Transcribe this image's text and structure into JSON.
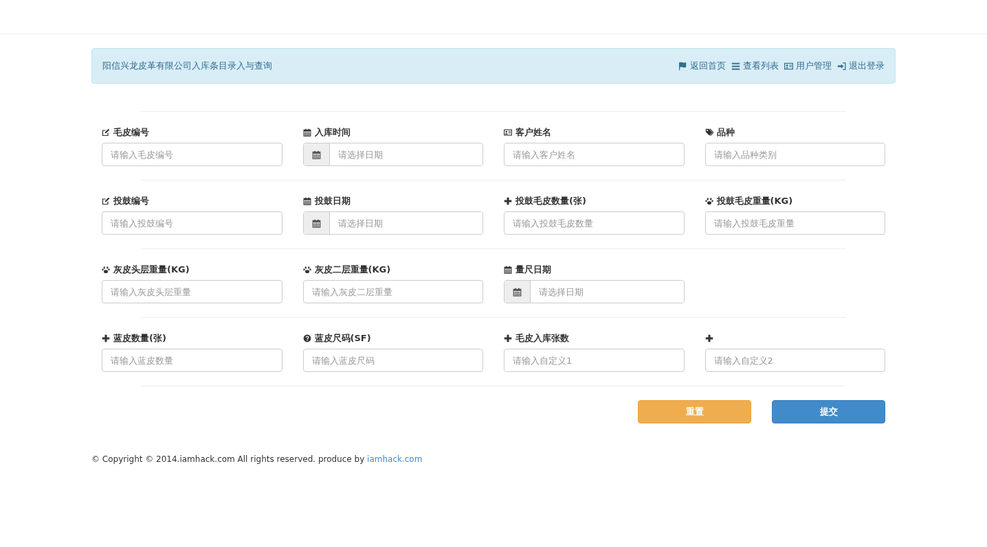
{
  "navbar": {
    "title": "阳信兴龙皮革有限公司入库条目录入与查询",
    "links": [
      {
        "label": "返回首页"
      },
      {
        "label": "查看列表"
      },
      {
        "label": "用户管理"
      },
      {
        "label": "退出登录"
      }
    ]
  },
  "form_rows": [
    {
      "fields": [
        {
          "label": "毛皮编号",
          "kind": "text",
          "placeholder": "请输入毛皮编号"
        },
        {
          "label": "入库时间",
          "kind": "date",
          "placeholder": "请选择日期"
        },
        {
          "label": "客户姓名",
          "kind": "text",
          "placeholder": "请输入客户姓名"
        },
        {
          "label": "品种",
          "kind": "text",
          "placeholder": "请输入品种类别"
        }
      ]
    },
    {
      "fields": [
        {
          "label": "投鼓编号",
          "kind": "text",
          "placeholder": "请输入投鼓编号"
        },
        {
          "label": "投鼓日期",
          "kind": "date",
          "placeholder": "请选择日期"
        },
        {
          "label": "投鼓毛皮数量(张)",
          "kind": "text",
          "placeholder": "请输入投鼓毛皮数量"
        },
        {
          "label": "投鼓毛皮重量(KG)",
          "kind": "text",
          "placeholder": "请输入投鼓毛皮重量"
        }
      ]
    },
    {
      "fields": [
        {
          "label": "灰皮头层重量(KG)",
          "kind": "text",
          "placeholder": "请输入灰皮头层重量"
        },
        {
          "label": "灰皮二层重量(KG)",
          "kind": "text",
          "placeholder": "请输入灰皮二层重量"
        },
        {
          "label": "量尺日期",
          "kind": "date",
          "placeholder": "请选择日期"
        }
      ]
    },
    {
      "fields": [
        {
          "label": "蓝皮数量(张)",
          "kind": "text",
          "placeholder": "请输入蓝皮数量"
        },
        {
          "label": "蓝皮尺码(SF)",
          "kind": "text",
          "placeholder": "请输入蓝皮尺码"
        },
        {
          "label": "毛皮入库张数",
          "kind": "text",
          "placeholder": "请输入自定义1"
        },
        {
          "kind": "text",
          "placeholder": "请输入自定义2"
        }
      ]
    }
  ],
  "buttons": [
    {
      "kind": "warning",
      "label": "重置"
    },
    {
      "kind": "primary",
      "label": "提交"
    }
  ],
  "footer": {
    "text": "© Copyright © 2014.iamhack.com All rights reserved. produce by ",
    "link": "iamhack.com"
  }
}
